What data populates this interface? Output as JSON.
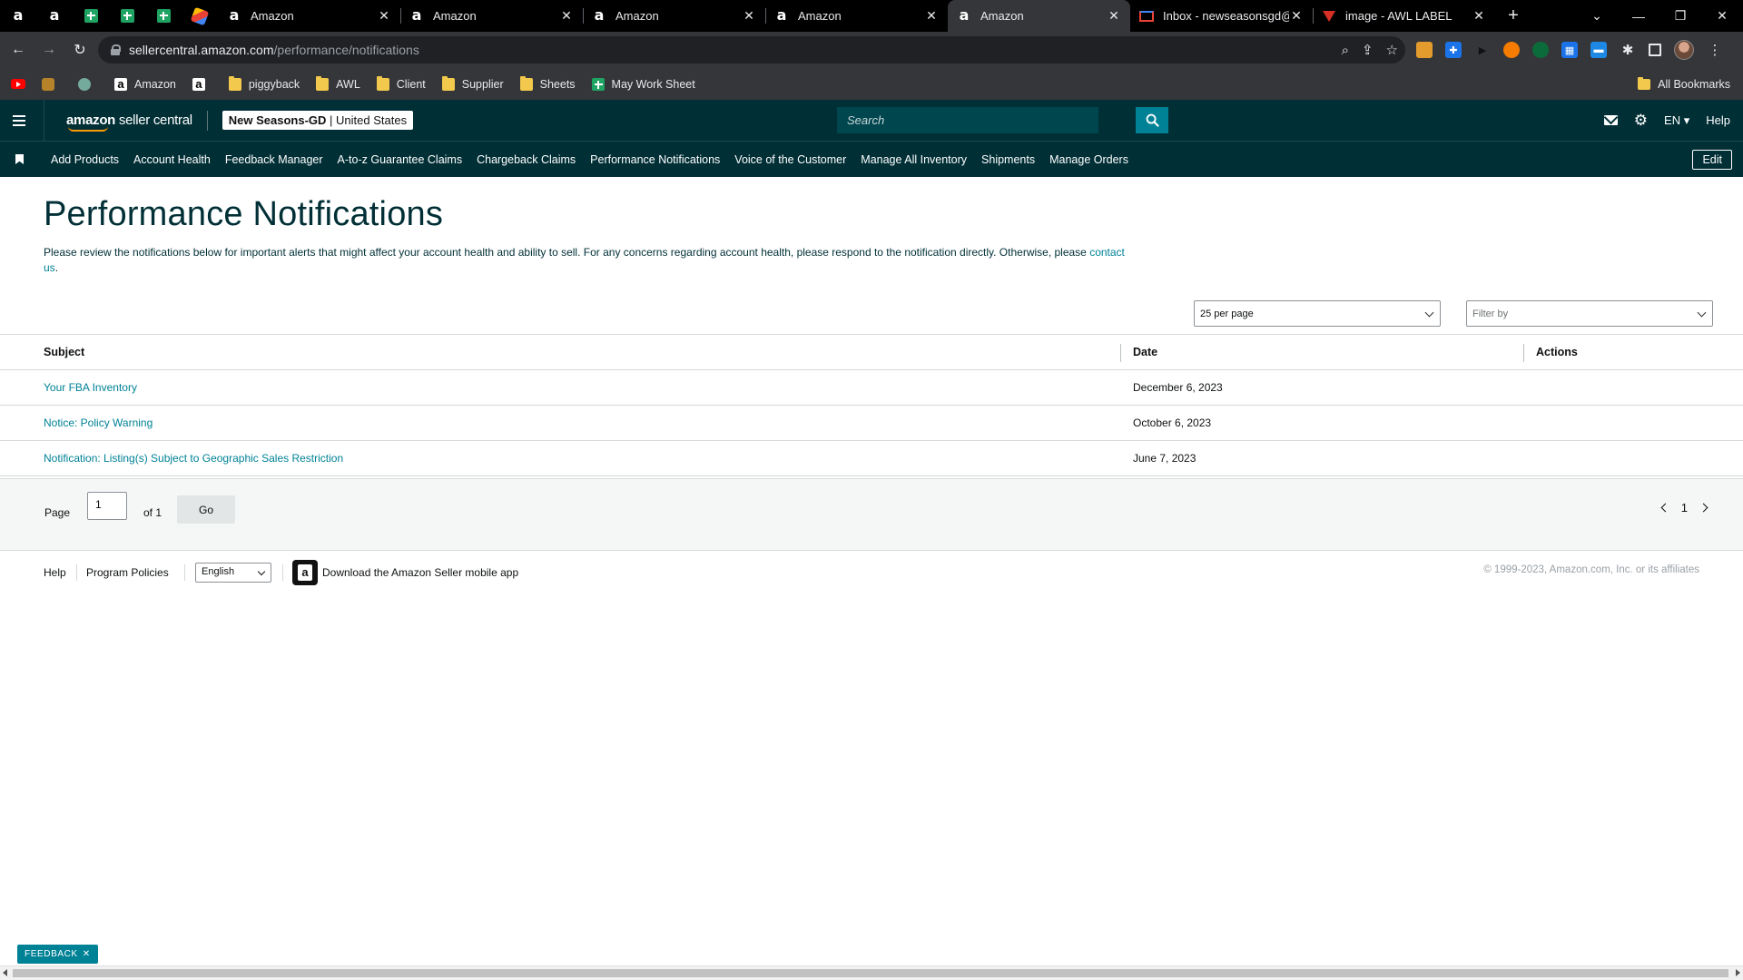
{
  "browser": {
    "tabs": [
      {
        "title": "Amazon"
      },
      {
        "title": "Amazon"
      },
      {
        "title": "Amazon"
      },
      {
        "title": "Amazon"
      },
      {
        "title": "Amazon"
      },
      {
        "title": "Inbox - newseasonsgd@"
      },
      {
        "title": "image - AWL LABEL"
      }
    ],
    "active_tab_index": 4,
    "url_host": "sellercentral.amazon.com",
    "url_path": "/performance/notifications",
    "bookmarks": [
      {
        "label": "Amazon"
      },
      {
        "label": "piggyback"
      },
      {
        "label": "AWL"
      },
      {
        "label": "Client"
      },
      {
        "label": "Supplier"
      },
      {
        "label": "Sheets"
      },
      {
        "label": "May Work Sheet"
      }
    ],
    "all_bookmarks_label": "All Bookmarks"
  },
  "header": {
    "logo_bold": "amazon",
    "logo_light": " seller central",
    "store_name": "New Seasons-GD",
    "store_region": "United States",
    "search_placeholder": "Search",
    "language": "EN",
    "help": "Help"
  },
  "nav": {
    "items": [
      "Add Products",
      "Account Health",
      "Feedback Manager",
      "A-to-z Guarantee Claims",
      "Chargeback Claims",
      "Performance Notifications",
      "Voice of the Customer",
      "Manage All Inventory",
      "Shipments",
      "Manage Orders"
    ],
    "edit_label": "Edit"
  },
  "main": {
    "title": "Performance Notifications",
    "intro": "Please review the notifications below for important alerts that might affect your account health and ability to sell. For any concerns regarding account health, please respond to the notification directly. Otherwise, please",
    "contact_link": "contact us",
    "per_page": "25 per page",
    "filter_placeholder": "Filter by",
    "columns": {
      "subject": "Subject",
      "date": "Date",
      "actions": "Actions"
    },
    "rows": [
      {
        "subject": "Your FBA Inventory",
        "date": "December 6, 2023"
      },
      {
        "subject": "Notice: Policy Warning",
        "date": "October 6, 2023"
      },
      {
        "subject": "Notification: Listing(s) Subject to Geographic Sales Restriction",
        "date": "June 7, 2023"
      }
    ],
    "pager": {
      "page_label": "Page",
      "page_value": "1",
      "of_label": "of 1",
      "go_label": "Go",
      "current_page": "1"
    }
  },
  "footer": {
    "help": "Help",
    "program_policies": "Program Policies",
    "language": "English",
    "app_text": "Download the Amazon Seller mobile app",
    "copyright": "© 1999-2023, Amazon.com, Inc. or its affiliates"
  },
  "feedback_label": "FEEDBACK"
}
